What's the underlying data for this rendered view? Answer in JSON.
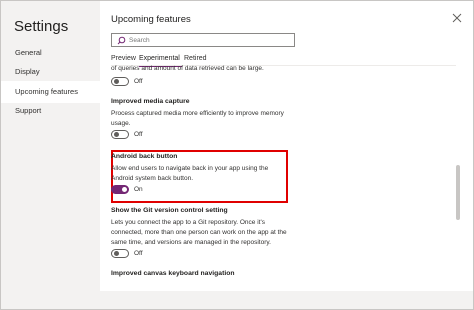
{
  "nav": {
    "title": "Settings",
    "items": [
      {
        "label": "General"
      },
      {
        "label": "Display"
      },
      {
        "label": "Upcoming features",
        "active": true
      },
      {
        "label": "Support"
      }
    ]
  },
  "main": {
    "title": "Upcoming features",
    "search": {
      "placeholder": "Search",
      "value": ""
    },
    "tabs": [
      {
        "label": "Preview"
      },
      {
        "label": "Experimental",
        "active": true
      },
      {
        "label": "Retired"
      }
    ],
    "features": [
      {
        "heading": "",
        "description": "of queries and amount of data retrieved can be large.",
        "toggle": "Off",
        "on": false
      },
      {
        "heading": "Improved media capture",
        "description_lines": [
          "Process captured media more efficiently to improve memory",
          "usage."
        ],
        "toggle": "Off",
        "on": false
      },
      {
        "heading": "Android back button",
        "description_lines": [
          "Allow end users to navigate back in your app using the",
          "Android system back button."
        ],
        "toggle": "On",
        "on": true
      },
      {
        "heading": "Show the Git version control setting",
        "description_lines": [
          "Lets you connect the app to a Git repository. Once it's",
          "connected, more than one person can work on the app at the",
          "same time, and versions are managed in the repository."
        ],
        "toggle": "Off",
        "on": false
      },
      {
        "heading": "Improved canvas keyboard navigation"
      }
    ]
  },
  "colors": {
    "accent": "#742774",
    "highlight": "#e00000",
    "nav_bg": "#f3f2f1"
  },
  "icons": {
    "search": "search-icon",
    "close": "close-icon"
  }
}
